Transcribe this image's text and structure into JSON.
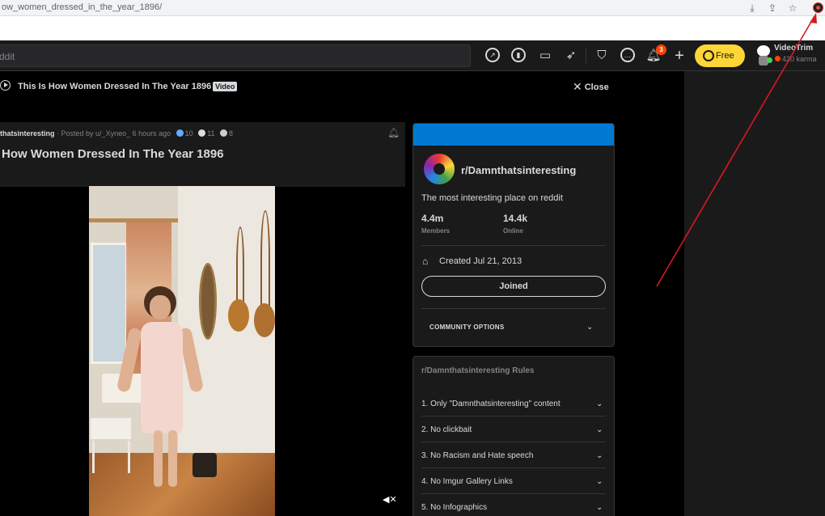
{
  "browser": {
    "url": "ow_women_dressed_in_the_year_1896/"
  },
  "header": {
    "search_placeholder": "ddit",
    "notif_count": "3",
    "free_label": "Free",
    "username": "VideoTrim",
    "karma": "420 karma"
  },
  "post_bar": {
    "title": "This Is How Women Dressed In The Year 1896",
    "tag": "Video",
    "close_label": "Close"
  },
  "post": {
    "subreddit": "thatsinteresting",
    "posted_by": "· Posted by u/_Xyneo_ 6 hours ago",
    "award_counts": [
      "10",
      "11",
      "8"
    ],
    "title": "How Women Dressed In The Year 1896"
  },
  "community": {
    "name": "r/Damnthatsinteresting",
    "description": "The most interesting place on reddit",
    "members_value": "4.4m",
    "members_label": "Members",
    "online_value": "14.4k",
    "online_label": "Online",
    "created": "Created Jul 21, 2013",
    "joined_label": "Joined",
    "options_label": "COMMUNITY OPTIONS"
  },
  "rules": {
    "title": "r/Damnthatsinteresting Rules",
    "items": [
      "1. Only \"Damnthatsinteresting\" content",
      "2. No clickbait",
      "3. No Racism and Hate speech",
      "4. No Imgur Gallery Links",
      "5. No Infographics"
    ]
  },
  "colors": {
    "accent": "#0079d3",
    "brand_orange": "#ff4500",
    "premium_yellow": "#ffd635",
    "annotation_red": "#d71920"
  },
  "icons": [
    "popular-icon",
    "stats-icon",
    "tv-icon",
    "rocket-icon",
    "shield-icon",
    "chat-icon",
    "bell-icon",
    "plus-icon",
    "coin-icon",
    "mute-icon",
    "cake-icon",
    "chevron-down-icon"
  ]
}
